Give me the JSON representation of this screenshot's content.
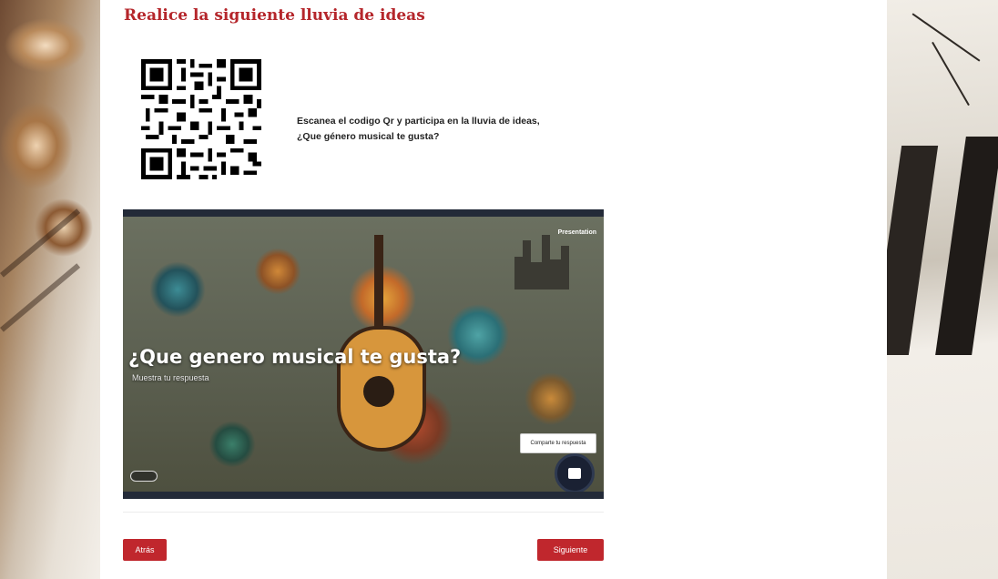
{
  "page": {
    "title": "Realice la siguiente lluvia de ideas",
    "instruction_line1": "Escanea el codigo Qr y participa en la lluvia de ideas,",
    "instruction_line2": "¿Que género musical te gusta?"
  },
  "embed": {
    "slide_title": "¿Que genero musical te gusta?",
    "slide_subtitle": "Muestra tu respuesta",
    "brand": "Presentation",
    "answer_button": "Comparte tu respuesta"
  },
  "navigation": {
    "back_label": "Atrás",
    "next_label": "Siguiente"
  },
  "colors": {
    "accent": "#c0272d",
    "title": "#b5262b"
  },
  "icons": {
    "qr": "qr-code-icon",
    "chat": "chat-bubble-icon"
  }
}
